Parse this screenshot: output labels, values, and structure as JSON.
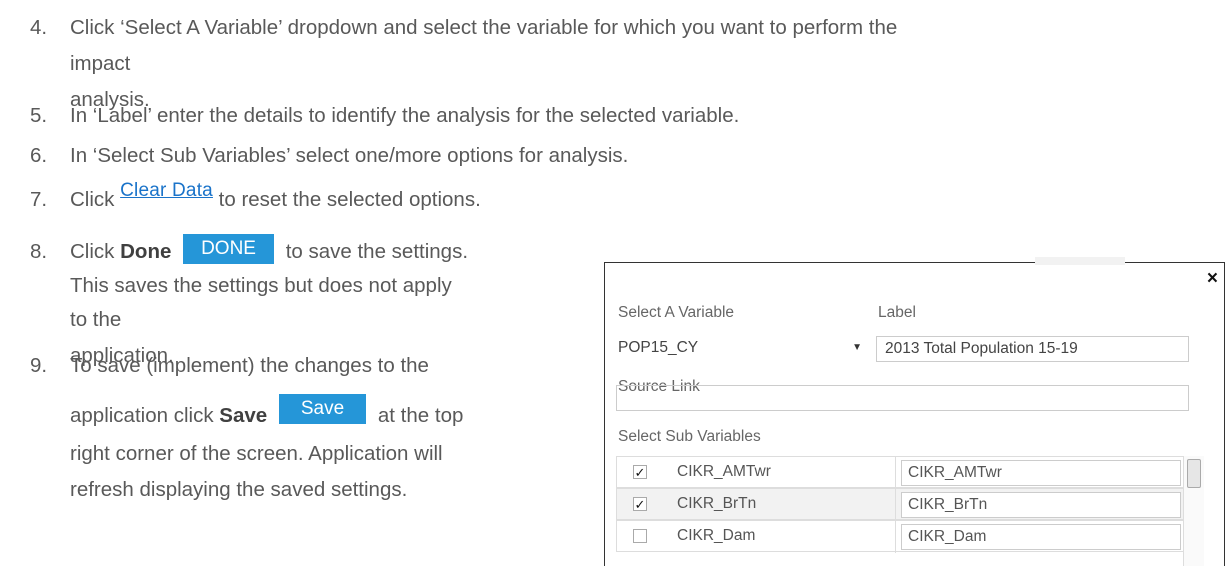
{
  "steps": [
    {
      "num": "4.",
      "line1": "Click ‘Select A Variable’ dropdown and select the variable for which you want to perform the",
      "line2": "impact analysis."
    },
    {
      "num": "5.",
      "line1": "In ‘Label’ enter the details to identify the analysis for the selected variable."
    },
    {
      "num": "6.",
      "line1": "In ‘Select Sub Variables’ select one/more options for analysis."
    },
    {
      "num": "7.",
      "pre": "Click",
      "link": "Clear Data",
      "post": "to reset the selected options."
    },
    {
      "num": "8.",
      "pre": "Click",
      "bold": "Done",
      "button": "DONE",
      "post": "to save the settings.",
      "line2": "This saves the settings but does not apply",
      "line3": "to the application."
    },
    {
      "num": "9.",
      "line1": "To save (implement) the changes to the",
      "pre": "application click",
      "bold": "Save",
      "button": "Save",
      "post": "at the top",
      "line3": "right corner of the screen. Application will",
      "line4": "refresh displaying the saved settings."
    }
  ],
  "dialog": {
    "close_icon": "×",
    "variable_label": "Select A Variable",
    "variable_value": "POP15_CY",
    "label_label": "Label",
    "label_value": "2013 Total Population 15-19",
    "source_label": "Source Link",
    "source_value": "",
    "sub_label": "Select Sub Variables",
    "rows": [
      {
        "checked": "✓",
        "name": "CIKR_AMTwr",
        "value": "CIKR_AMTwr"
      },
      {
        "checked": "✓",
        "name": "CIKR_BrTn",
        "value": "CIKR_BrTn"
      },
      {
        "checked": "",
        "name": "CIKR_Dam",
        "value": "CIKR_Dam"
      }
    ]
  }
}
